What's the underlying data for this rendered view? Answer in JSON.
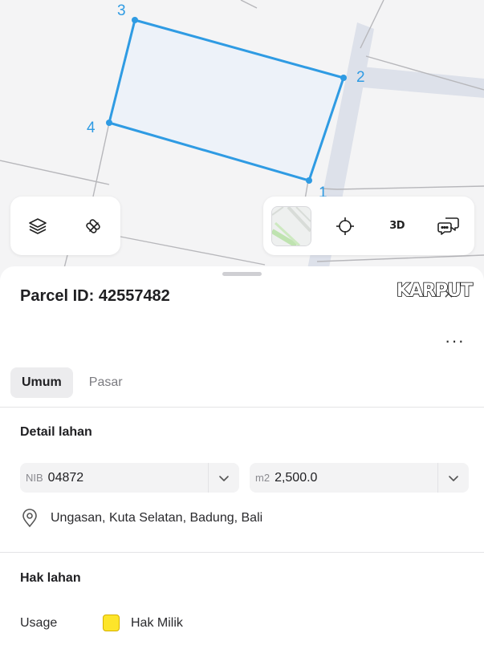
{
  "map": {
    "vertex_labels": [
      "1",
      "2",
      "3",
      "4"
    ],
    "parcel_outline_color": "#2f9be3",
    "parcel_fill_color": "#edf2f9"
  },
  "toolbar_left": {
    "layers_icon": "layers-icon",
    "measure_icon": "measure-icon"
  },
  "toolbar_right": {
    "basemap_icon": "basemap-thumbnail",
    "locate_icon": "crosshair-icon",
    "btn_3d_label": "3D",
    "feedback_icon": "chat-bubbles-icon"
  },
  "sheet": {
    "title": "Parcel ID: 42557482",
    "logo_text": "KARPUT",
    "close_glyph": "×",
    "more_glyph": "···",
    "tabs": [
      {
        "label": "Umum",
        "active": true
      },
      {
        "label": "Pasar",
        "active": false
      }
    ],
    "detail_section": {
      "title": "Detail lahan",
      "nib": {
        "prefix": "NIB",
        "value": "04872"
      },
      "area": {
        "prefix": "m2",
        "value": "2,500.0"
      },
      "location": "Ungasan, Kuta Selatan, Badung, Bali"
    },
    "rights_section": {
      "title": "Hak lahan",
      "usage_label": "Usage",
      "usage_value": "Hak Milik",
      "usage_color": "#fde52a"
    }
  }
}
